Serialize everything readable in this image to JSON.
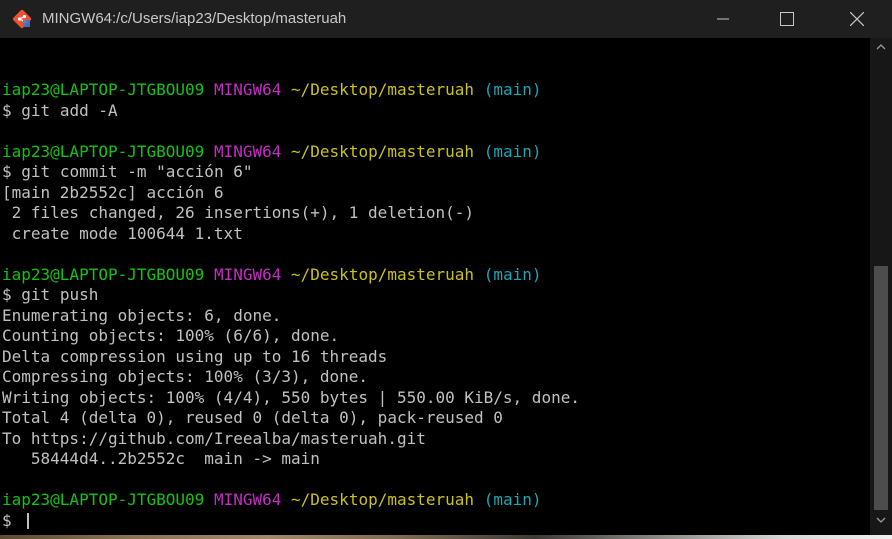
{
  "window": {
    "title": "MINGW64:/c/Users/iap23/Desktop/masteruah",
    "app_icon": "git-bash-icon",
    "controls": [
      "minimize-icon",
      "maximize-icon",
      "close-icon"
    ]
  },
  "colors": {
    "user_host": "#13c313",
    "env": "#c52cc5",
    "path": "#c9c11a",
    "branch": "#1aa7b6",
    "text": "#c0c0c0",
    "background": "#000000"
  },
  "prompt": {
    "user_host": "iap23@LAPTOP-JTGBOU09",
    "env": "MINGW64",
    "path": "~/Desktop/masteruah",
    "branch": "(main)",
    "symbol": "$"
  },
  "blocks": [
    {
      "command": "git add -A",
      "output": []
    },
    {
      "command": "git commit -m \"acción 6\"",
      "output": [
        "[main 2b2552c] acción 6",
        " 2 files changed, 26 insertions(+), 1 deletion(-)",
        " create mode 100644 1.txt"
      ]
    },
    {
      "command": "git push",
      "output": [
        "Enumerating objects: 6, done.",
        "Counting objects: 100% (6/6), done.",
        "Delta compression using up to 16 threads",
        "Compressing objects: 100% (3/3), done.",
        "Writing objects: 100% (4/4), 550 bytes | 550.00 KiB/s, done.",
        "Total 4 (delta 0), reused 0 (delta 0), pack-reused 0",
        "To https://github.com/Ireealba/masteruah.git",
        "   58444d4..2b2552c  main -> main"
      ]
    }
  ],
  "current_command": ""
}
